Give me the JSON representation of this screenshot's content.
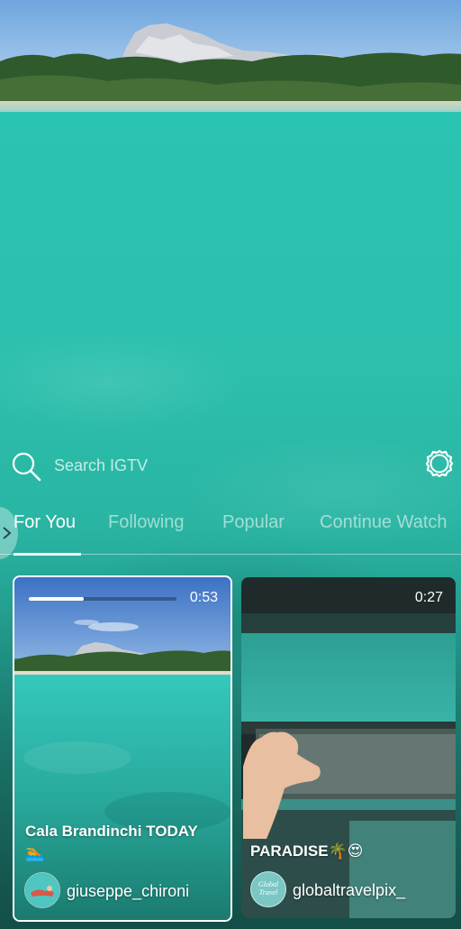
{
  "search": {
    "placeholder": "Search IGTV"
  },
  "tabs": [
    {
      "label": "For You",
      "active": true
    },
    {
      "label": "Following",
      "active": false
    },
    {
      "label": "Popular",
      "active": false
    },
    {
      "label": "Continue Watch",
      "active": false
    }
  ],
  "cards": [
    {
      "duration": "0:53",
      "progress": 0.37,
      "title": "Cala Brandinchi TODAY",
      "title_emoji": "🏊",
      "username": "giuseppe_chironi",
      "selected": true
    },
    {
      "duration": "0:27",
      "title": "PARADISE🌴😍",
      "username": "globaltravelpix_",
      "avatar_text": "Global Travel"
    }
  ],
  "colors": {
    "sea": "#2bc3b2",
    "accent": "#ffffff"
  },
  "icons": [
    "search-icon",
    "settings-icon",
    "chevron-right-icon"
  ]
}
